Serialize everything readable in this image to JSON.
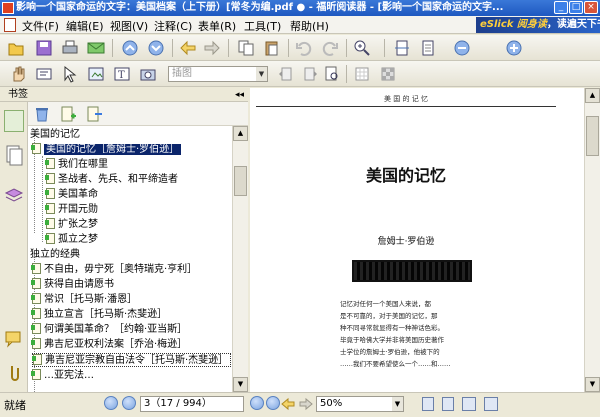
{
  "window": {
    "title": "影响一个国家命运的文字：美国档案（上下册）[常冬为编.pdf ● - 福昕阅读器 - [影响一个国家命运的文字...",
    "minimize": "_",
    "maximize": "□",
    "close": "×"
  },
  "menu": {
    "items": [
      "文件(F)",
      "编辑(E)",
      "视图(V)",
      "注释(C)",
      "表单(R)",
      "工具(T)",
      "帮助(H)"
    ]
  },
  "ad": {
    "brand": "eSlick 阅身读",
    "slogan": "，读遍天下书！"
  },
  "toolbar": {
    "zoom_placeholder": "插图"
  },
  "panel": {
    "title": "书签",
    "collapse": "◂◂"
  },
  "bookmarks": [
    {
      "label": "美国的记忆",
      "level": 0
    },
    {
      "label": "美国的记忆［詹姆士·罗伯逊］",
      "level": 1,
      "selected": true
    },
    {
      "label": "我们在哪里",
      "level": 2
    },
    {
      "label": "圣战者、先兵、和平缔造者",
      "level": 2
    },
    {
      "label": "美国革命",
      "level": 2
    },
    {
      "label": "开国元勋",
      "level": 2
    },
    {
      "label": "扩张之梦",
      "level": 2
    },
    {
      "label": "孤立之梦",
      "level": 2
    },
    {
      "label": "独立的经典",
      "level": 0
    },
    {
      "label": "不自由，毋宁死［奥特瑞克·亨利］",
      "level": 1
    },
    {
      "label": "获得自由请愿书",
      "level": 1
    },
    {
      "label": "常识［托马斯·潘恩］",
      "level": 1
    },
    {
      "label": "独立宣言［托马斯·杰斐逊］",
      "level": 1
    },
    {
      "label": "何谓美国革命？［约翰·亚当斯］",
      "level": 1
    },
    {
      "label": "弗吉尼亚权利法案［乔治·梅逊］",
      "level": 1
    },
    {
      "label": "弗吉尼亚宗教自由法令［托马斯·杰斐逊］",
      "level": 1,
      "boxed": true
    },
    {
      "label": "…亚宪法…",
      "level": 1
    }
  ],
  "document": {
    "running_head": "美 国 的 记 忆",
    "chapter_title": "美国的记忆",
    "author": "詹姆士·罗伯逊",
    "body_lines": [
      "记忆对任何一个美国人来说，都",
      "是不可靠的，对于美国的记忆，那",
      "种不同寻常就显得有一种神话色彩。",
      "毕竟于哈佛大学并非将美国历史著作",
      "士学位的詹姆士·罗伯逊，他被下的",
      "……我们不要希望使么一个……和……"
    ]
  },
  "status": {
    "text": "就绪",
    "page": "3（17 / 994）",
    "zoom": "50%"
  }
}
